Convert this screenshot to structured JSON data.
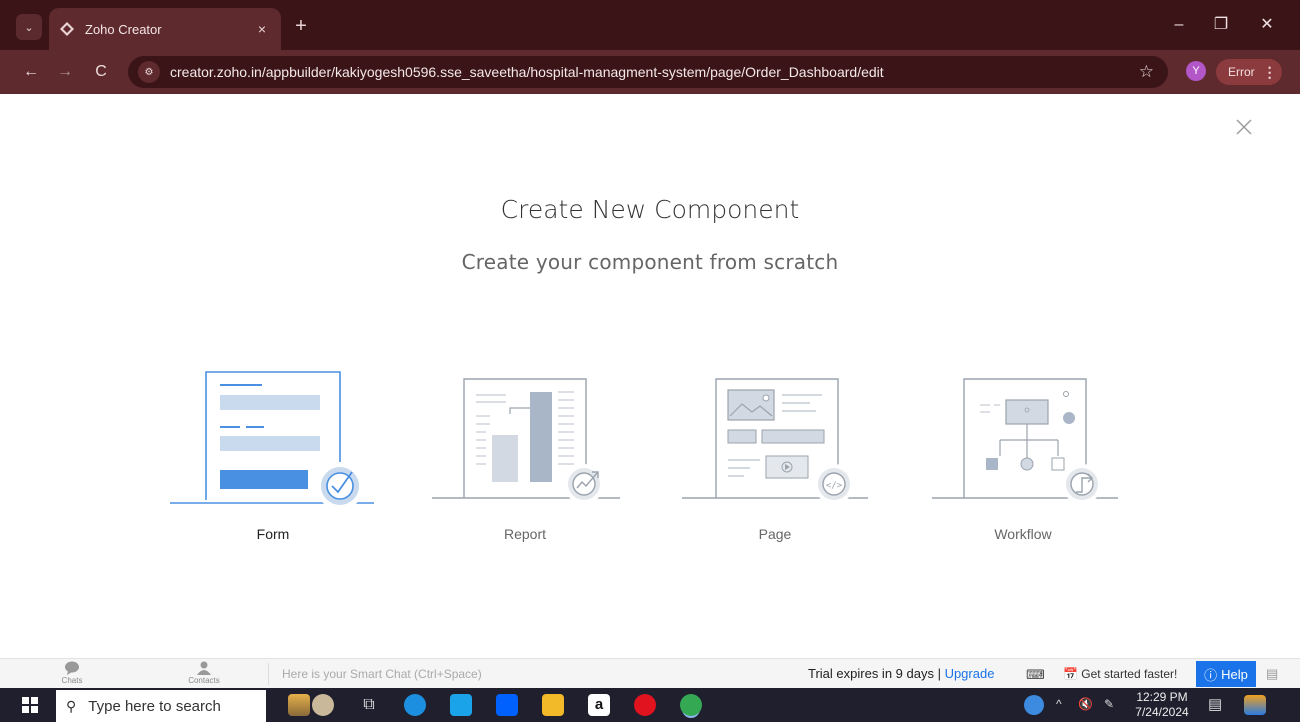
{
  "browser": {
    "tab_title": "Zoho Creator",
    "tab_close": "×",
    "new_tab": "+",
    "url": "creator.zoho.in/appbuilder/kakiyogesh0596.sse_saveetha/hospital-managment-system/page/Order_Dashboard/edit",
    "profile_initial": "Y",
    "error_label": "Error",
    "minimize": "–",
    "restore": "❐",
    "close": "✕",
    "back": "←",
    "forward": "→",
    "reload": "C",
    "star": "☆"
  },
  "dialog": {
    "title": "Create New Component",
    "subtitle": "Create your component from scratch",
    "options": [
      {
        "label": "Form",
        "icon": "form-illustration-icon",
        "selected": true
      },
      {
        "label": "Report",
        "icon": "report-illustration-icon",
        "selected": false
      },
      {
        "label": "Page",
        "icon": "page-illustration-icon",
        "selected": false
      },
      {
        "label": "Workflow",
        "icon": "workflow-illustration-icon",
        "selected": false
      }
    ]
  },
  "zoho_bar": {
    "chats": "Chats",
    "contacts": "Contacts",
    "smart_chat_placeholder": "Here is your Smart Chat (Ctrl+Space)",
    "trial_text": "Trial expires in 9 days | ",
    "upgrade": "Upgrade",
    "get_started": "Get started faster!",
    "help": "Help"
  },
  "taskbar": {
    "search_placeholder": "Type here to search",
    "time": "12:29 PM",
    "date": "7/24/2024"
  },
  "colors": {
    "accent": "#1a73e8",
    "form_blue": "#4a90e2",
    "chrome_dark": "#3a1417",
    "chrome_mid": "#5e2a2e"
  }
}
